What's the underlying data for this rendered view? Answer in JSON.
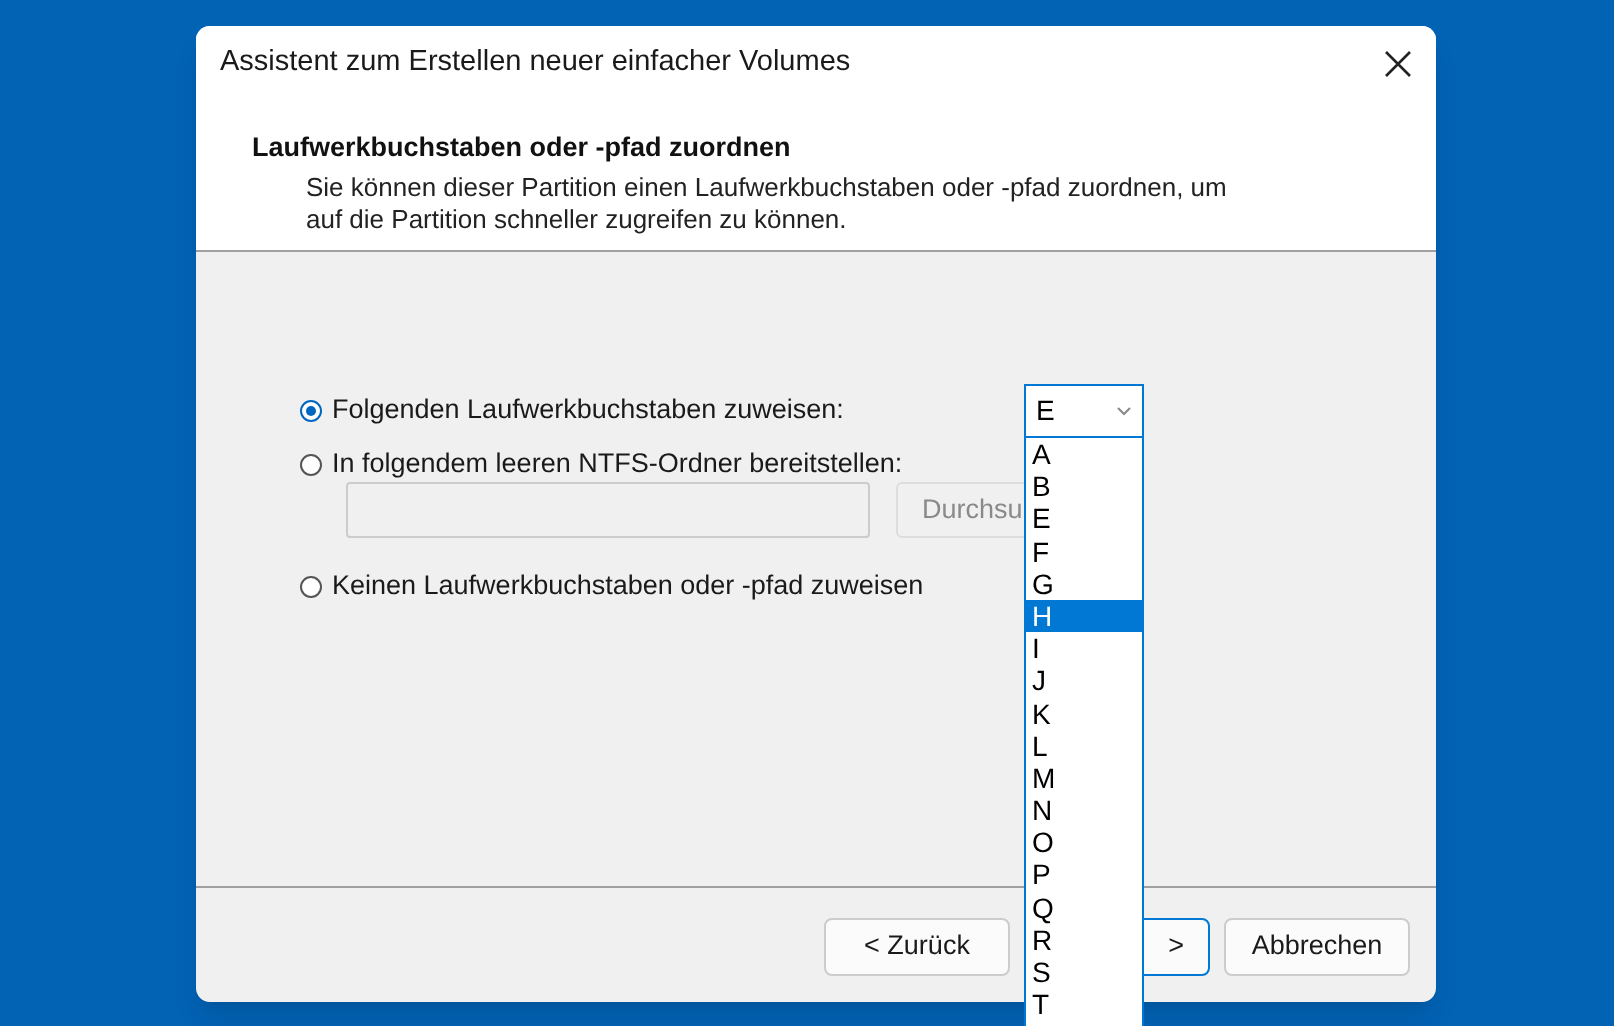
{
  "window": {
    "title": "Assistent zum Erstellen neuer einfacher Volumes"
  },
  "header": {
    "heading": "Laufwerkbuchstaben oder -pfad zuordnen",
    "description_lines": [
      "Sie können dieser Partition einen Laufwerkbuchstaben oder -pfad zuordnen, um",
      "auf die Partition schneller zugreifen zu können."
    ]
  },
  "options": [
    {
      "label": "Folgenden Laufwerkbuchstaben zuweisen:",
      "selected": true,
      "kind": "letter"
    },
    {
      "label": "In folgendem leeren NTFS-Ordner bereitstellen:",
      "selected": false,
      "kind": "folder"
    },
    {
      "label": "Keinen Laufwerkbuchstaben oder -pfad zuweisen",
      "selected": false,
      "kind": "none"
    }
  ],
  "drive_letter": {
    "value": "E",
    "expanded": true,
    "options": [
      {
        "label": "A",
        "highlighted": false
      },
      {
        "label": "B",
        "highlighted": false
      },
      {
        "label": "E",
        "highlighted": false
      },
      {
        "label": "F",
        "highlighted": false
      },
      {
        "label": "G",
        "highlighted": false
      },
      {
        "label": "H",
        "highlighted": true
      },
      {
        "label": "I",
        "highlighted": false
      },
      {
        "label": "J",
        "highlighted": false
      },
      {
        "label": "K",
        "highlighted": false
      },
      {
        "label": "L",
        "highlighted": false
      },
      {
        "label": "M",
        "highlighted": false
      },
      {
        "label": "N",
        "highlighted": false
      },
      {
        "label": "O",
        "highlighted": false
      },
      {
        "label": "P",
        "highlighted": false
      },
      {
        "label": "Q",
        "highlighted": false
      },
      {
        "label": "R",
        "highlighted": false
      },
      {
        "label": "S",
        "highlighted": false
      },
      {
        "label": "T",
        "highlighted": false
      }
    ]
  },
  "folder": {
    "browse_button": "Durchsu",
    "disabled": true
  },
  "buttons": [
    {
      "label": "< Zurück",
      "default": false
    },
    {
      "label": ">",
      "default": true
    },
    {
      "label": "Abbrechen",
      "default": false
    }
  ]
}
